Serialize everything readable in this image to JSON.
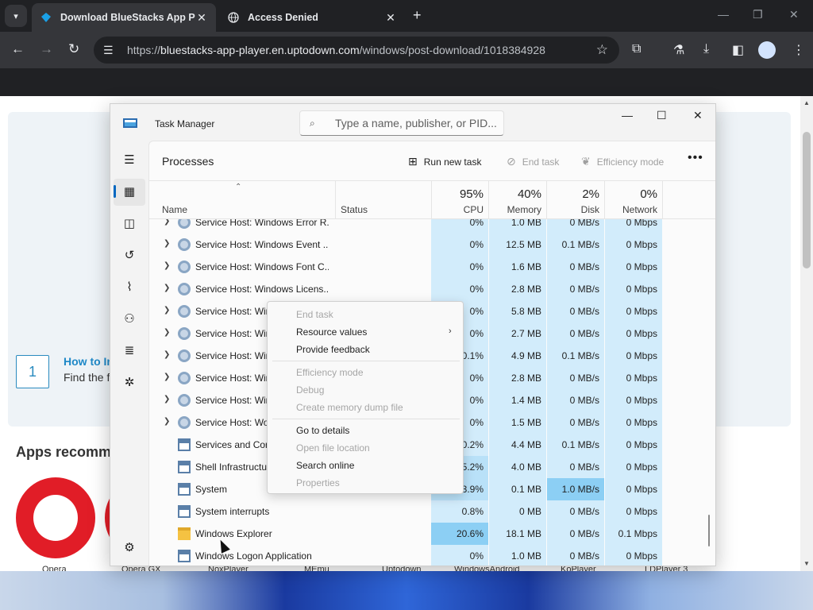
{
  "browser": {
    "tabs": [
      {
        "title": "Download BlueStacks App Play",
        "active": true
      },
      {
        "title": "Access Denied",
        "active": false
      }
    ],
    "url_prefix": "https://",
    "url_host": "bluestacks-app-player.en.uptodown.com",
    "url_path": "/windows/post-download/1018384928"
  },
  "webpage": {
    "step_number": "1",
    "step_title": "How to In",
    "step_sub": "Find the f",
    "apps_heading": "Apps recomme",
    "app_names": [
      "Opera",
      "Opera GX",
      "NoxPlayer",
      "MEmu",
      "Uptodown",
      "WindowsAndroid",
      "KoPlayer",
      "LDPlayer 3"
    ]
  },
  "taskmanager": {
    "title": "Task Manager",
    "search_placeholder": "Type a name, publisher, or PID...",
    "page_title": "Processes",
    "actions": {
      "run_new_task": "Run new task",
      "end_task": "End task",
      "efficiency_mode": "Efficiency mode"
    },
    "columns": {
      "name": "Name",
      "status": "Status",
      "cpu": {
        "pct": "95%",
        "label": "CPU"
      },
      "memory": {
        "pct": "40%",
        "label": "Memory"
      },
      "disk": {
        "pct": "2%",
        "label": "Disk"
      },
      "network": {
        "pct": "0%",
        "label": "Network"
      }
    },
    "rows": [
      {
        "name": "Service Host: Windows Error R...",
        "cpu": "0%",
        "mem": "1.0 MB",
        "disk": "0 MB/s",
        "net": "0 Mbps",
        "expand": true,
        "icon": "gear",
        "partial": true
      },
      {
        "name": "Service Host: Windows Event ...",
        "cpu": "0%",
        "mem": "12.5 MB",
        "disk": "0.1 MB/s",
        "net": "0 Mbps",
        "expand": true,
        "icon": "gear"
      },
      {
        "name": "Service Host: Windows Font C...",
        "cpu": "0%",
        "mem": "1.6 MB",
        "disk": "0 MB/s",
        "net": "0 Mbps",
        "expand": true,
        "icon": "gear"
      },
      {
        "name": "Service Host: Windows Licens...",
        "cpu": "0%",
        "mem": "2.8 MB",
        "disk": "0 MB/s",
        "net": "0 Mbps",
        "expand": true,
        "icon": "gear"
      },
      {
        "name": "Service Host: Win",
        "cpu": "0%",
        "mem": "5.8 MB",
        "disk": "0 MB/s",
        "net": "0 Mbps",
        "expand": true,
        "icon": "gear"
      },
      {
        "name": "Service Host: Win",
        "cpu": "0%",
        "mem": "2.7 MB",
        "disk": "0 MB/s",
        "net": "0 Mbps",
        "expand": true,
        "icon": "gear"
      },
      {
        "name": "Service Host: Win",
        "cpu": "0.1%",
        "mem": "4.9 MB",
        "disk": "0.1 MB/s",
        "net": "0 Mbps",
        "expand": true,
        "icon": "gear"
      },
      {
        "name": "Service Host: Win",
        "cpu": "0%",
        "mem": "2.8 MB",
        "disk": "0 MB/s",
        "net": "0 Mbps",
        "expand": true,
        "icon": "gear"
      },
      {
        "name": "Service Host: Win",
        "cpu": "0%",
        "mem": "1.4 MB",
        "disk": "0 MB/s",
        "net": "0 Mbps",
        "expand": true,
        "icon": "gear"
      },
      {
        "name": "Service Host: Wo",
        "cpu": "0%",
        "mem": "1.5 MB",
        "disk": "0 MB/s",
        "net": "0 Mbps",
        "expand": true,
        "icon": "gear"
      },
      {
        "name": "Services and Con",
        "cpu": "0.2%",
        "mem": "4.4 MB",
        "disk": "0.1 MB/s",
        "net": "0 Mbps",
        "expand": false,
        "icon": "win"
      },
      {
        "name": "Shell Infrastructu",
        "cpu": "5.2%",
        "mem": "4.0 MB",
        "disk": "0 MB/s",
        "net": "0 Mbps",
        "expand": false,
        "icon": "win",
        "cpu_heat": 2
      },
      {
        "name": "System",
        "cpu": "3.9%",
        "mem": "0.1 MB",
        "disk": "1.0 MB/s",
        "net": "0 Mbps",
        "expand": false,
        "icon": "win",
        "cpu_heat": 2,
        "disk_heat": 3
      },
      {
        "name": "System interrupts",
        "cpu": "0.8%",
        "mem": "0 MB",
        "disk": "0 MB/s",
        "net": "0 Mbps",
        "expand": false,
        "icon": "win"
      },
      {
        "name": "Windows Explorer",
        "cpu": "20.6%",
        "mem": "18.1 MB",
        "disk": "0 MB/s",
        "net": "0.1 Mbps",
        "expand": false,
        "icon": "folder",
        "cpu_heat": 3
      },
      {
        "name": "Windows Logon Application",
        "cpu": "0%",
        "mem": "1.0 MB",
        "disk": "0 MB/s",
        "net": "0 Mbps",
        "expand": false,
        "icon": "win"
      }
    ]
  },
  "context_menu": {
    "items": [
      {
        "label": "End task",
        "disabled": true
      },
      {
        "label": "Resource values",
        "disabled": false,
        "submenu": true
      },
      {
        "label": "Provide feedback",
        "disabled": false
      },
      {
        "label": "Efficiency mode",
        "disabled": true
      },
      {
        "label": "Debug",
        "disabled": true
      },
      {
        "label": "Create memory dump file",
        "disabled": true
      },
      {
        "label": "Go to details",
        "disabled": false
      },
      {
        "label": "Open file location",
        "disabled": true
      },
      {
        "label": "Search online",
        "disabled": false
      },
      {
        "label": "Properties",
        "disabled": true
      }
    ]
  },
  "colors": {
    "accent": "#0067c0",
    "heat_low": "#d2ecfb",
    "heat_mid": "#b9e1f8",
    "heat_high": "#8ccff4"
  }
}
